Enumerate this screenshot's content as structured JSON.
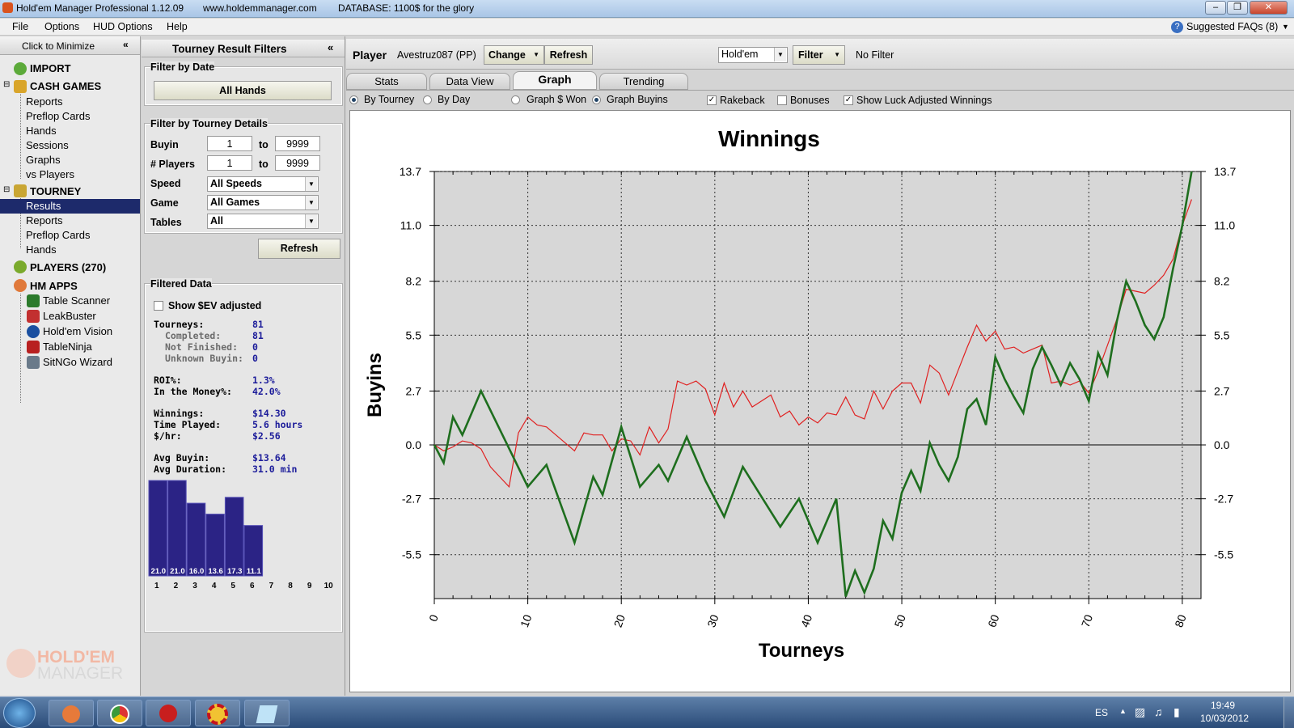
{
  "titlebar": {
    "app_title": "Hold'em Manager Professional 1.12.09",
    "website": "www.holdemmanager.com",
    "database": "DATABASE: 1100$ for the glory"
  },
  "menu": {
    "file": "File",
    "options": "Options",
    "hud_options": "HUD Options",
    "help": "Help",
    "faqs": "Suggested FAQs (8)"
  },
  "leftnav": {
    "minimize": "Click to Minimize",
    "import": "IMPORT",
    "cash_games": "CASH GAMES",
    "cash_items": [
      "Reports",
      "Preflop Cards",
      "Hands",
      "Sessions",
      "Graphs",
      "vs Players"
    ],
    "tourney": "TOURNEY",
    "tourney_items": [
      "Results",
      "Reports",
      "Preflop Cards",
      "Hands"
    ],
    "players": "PLAYERS (270)",
    "hm_apps": "HM APPS",
    "apps": [
      "Table Scanner",
      "LeakBuster",
      "Hold'em Vision",
      "TableNinja",
      "SitNGo Wizard"
    ],
    "logo_line1": "HOLD'EM",
    "logo_line2": "MANAGER"
  },
  "filters": {
    "title": "Tourney Result Filters",
    "by_date": "Filter by Date",
    "all_hands": "All Hands",
    "by_details": "Filter by Tourney Details",
    "buyin_label": "Buyin",
    "buyin_from": "1",
    "buyin_to": "9999",
    "players_label": "# Players",
    "players_from": "1",
    "players_to": "9999",
    "to": "to",
    "speed_label": "Speed",
    "speed_value": "All Speeds",
    "game_label": "Game",
    "game_value": "All Games",
    "tables_label": "Tables",
    "tables_value": "All",
    "refresh": "Refresh",
    "filtered_data": "Filtered Data",
    "show_ev": "Show $EV adjusted",
    "stats": [
      {
        "k": "Tourneys:",
        "v": "81"
      },
      {
        "k": "Completed:",
        "v": "81"
      },
      {
        "k": "Not Finished:",
        "v": "0"
      },
      {
        "k": "Unknown Buyin:",
        "v": "0"
      },
      {
        "k": "ROI%:",
        "v": "1.3%"
      },
      {
        "k": "In the Money%:",
        "v": "42.0%"
      },
      {
        "k": "Winnings:",
        "v": "$14.30"
      },
      {
        "k": "Time Played:",
        "v": "5.6 hours"
      },
      {
        "k": "$/hr:",
        "v": "$2.56"
      },
      {
        "k": "Avg Buyin:",
        "v": "$13.64"
      },
      {
        "k": "Avg Duration:",
        "v": "31.0 min"
      }
    ],
    "hist_values": [
      21.0,
      21.0,
      16.0,
      13.6,
      17.3,
      11.1,
      0,
      0,
      0,
      0
    ],
    "hist_labels": [
      "21.0",
      "21.0",
      "16.0",
      "13.6",
      "17.3",
      "11.1",
      "",
      "",
      "",
      ""
    ],
    "hist_cats": [
      "1",
      "2",
      "3",
      "4",
      "5",
      "6",
      "7",
      "8",
      "9",
      "10"
    ]
  },
  "main": {
    "player_label": "Player",
    "player_name": "Avestruz087 (PP)",
    "change": "Change",
    "refresh": "Refresh",
    "game_select": "Hold'em",
    "filter": "Filter",
    "no_filter": "No Filter",
    "tabs": [
      "Stats",
      "Data View",
      "Graph",
      "Trending"
    ],
    "by_tourney": "By Tourney",
    "by_day": "By Day",
    "graph_won": "Graph $ Won",
    "graph_buyins": "Graph Buyins",
    "rakeback": "Rakeback",
    "bonuses": "Bonuses",
    "show_luck": "Show Luck Adjusted Winnings"
  },
  "chart_data": {
    "type": "line",
    "title": "Winnings",
    "xlabel": "Tourneys",
    "ylabel": "Buyins",
    "xlim": [
      0,
      82
    ],
    "ylim": [
      -7.7,
      13.7
    ],
    "xticks": [
      0,
      10,
      20,
      30,
      40,
      50,
      60,
      70,
      80
    ],
    "yticks": [
      13.7,
      11.0,
      8.2,
      5.5,
      2.7,
      0.0,
      -2.7,
      -5.5
    ],
    "ytick_labels": [
      "13.7",
      "11.0",
      "8.2",
      "5.5",
      "2.7",
      "0.0",
      "-2.7",
      "-5.5"
    ],
    "grid": true,
    "series": [
      {
        "color": "#1e6e1e",
        "x": [
          0,
          1,
          2,
          3,
          5,
          10,
          12,
          15,
          17,
          18,
          20,
          22,
          24,
          25,
          27,
          29,
          31,
          33,
          35,
          37,
          39,
          41,
          43,
          44,
          45,
          46,
          47,
          48,
          49,
          50,
          51,
          52,
          53,
          54,
          55,
          56,
          57,
          58,
          59,
          60,
          61,
          62,
          63,
          64,
          65,
          66,
          67,
          68,
          69,
          70,
          71,
          72,
          73,
          74,
          75,
          76,
          77,
          78,
          79,
          80,
          81
        ],
        "y": [
          0,
          -0.9,
          1.4,
          0.5,
          2.7,
          -2.1,
          -1.0,
          -4.9,
          -1.6,
          -2.5,
          0.9,
          -2.1,
          -1.0,
          -1.8,
          0.4,
          -1.8,
          -3.6,
          -1.1,
          -2.6,
          -4.1,
          -2.7,
          -4.9,
          -2.7,
          -7.6,
          -6.3,
          -7.4,
          -6.2,
          -3.8,
          -4.7,
          -2.4,
          -1.3,
          -2.3,
          0.1,
          -1.0,
          -1.8,
          -0.6,
          1.8,
          2.3,
          1.0,
          4.4,
          3.3,
          2.4,
          1.6,
          3.8,
          4.9,
          4.0,
          3.0,
          4.1,
          3.3,
          2.2,
          4.6,
          3.5,
          6.2,
          8.2,
          7.2,
          6.0,
          5.3,
          6.4,
          8.8,
          11.0,
          13.7
        ]
      },
      {
        "color": "#e02020",
        "x": [
          0,
          1,
          2,
          3,
          4,
          5,
          6,
          7,
          8,
          9,
          10,
          11,
          12,
          13,
          14,
          15,
          16,
          17,
          18,
          19,
          20,
          21,
          22,
          23,
          24,
          25,
          26,
          27,
          28,
          29,
          30,
          31,
          32,
          33,
          34,
          35,
          36,
          37,
          38,
          39,
          40,
          41,
          42,
          43,
          44,
          45,
          46,
          47,
          48,
          49,
          50,
          51,
          52,
          53,
          54,
          55,
          56,
          57,
          58,
          59,
          60,
          61,
          62,
          63,
          64,
          65,
          66,
          67,
          68,
          69,
          70,
          71,
          72,
          73,
          74,
          75,
          76,
          77,
          78,
          79,
          80,
          81
        ],
        "y": [
          0,
          -0.3,
          -0.1,
          0.2,
          0.1,
          -0.2,
          -1.1,
          -1.6,
          -2.1,
          0.6,
          1.4,
          1.0,
          0.9,
          0.5,
          0.1,
          -0.3,
          0.6,
          0.5,
          0.5,
          -0.3,
          0.3,
          0.2,
          -0.5,
          0.9,
          0.1,
          0.8,
          3.2,
          3.0,
          3.2,
          2.8,
          1.5,
          3.1,
          1.9,
          2.7,
          1.9,
          2.2,
          2.5,
          1.4,
          1.7,
          1.0,
          1.4,
          1.1,
          1.6,
          1.5,
          2.4,
          1.5,
          1.3,
          2.7,
          1.8,
          2.7,
          3.1,
          3.1,
          2.1,
          4.0,
          3.6,
          2.5,
          3.7,
          4.9,
          6.0,
          5.2,
          5.7,
          4.8,
          4.9,
          4.6,
          4.8,
          5.0,
          3.1,
          3.2,
          3.0,
          3.2,
          2.6,
          3.7,
          5.0,
          6.3,
          7.8,
          7.7,
          7.6,
          8.0,
          8.5,
          9.3,
          11.0,
          12.3
        ]
      }
    ]
  },
  "taskbar": {
    "lang": "ES",
    "time": "19:49",
    "date": "10/03/2012"
  }
}
